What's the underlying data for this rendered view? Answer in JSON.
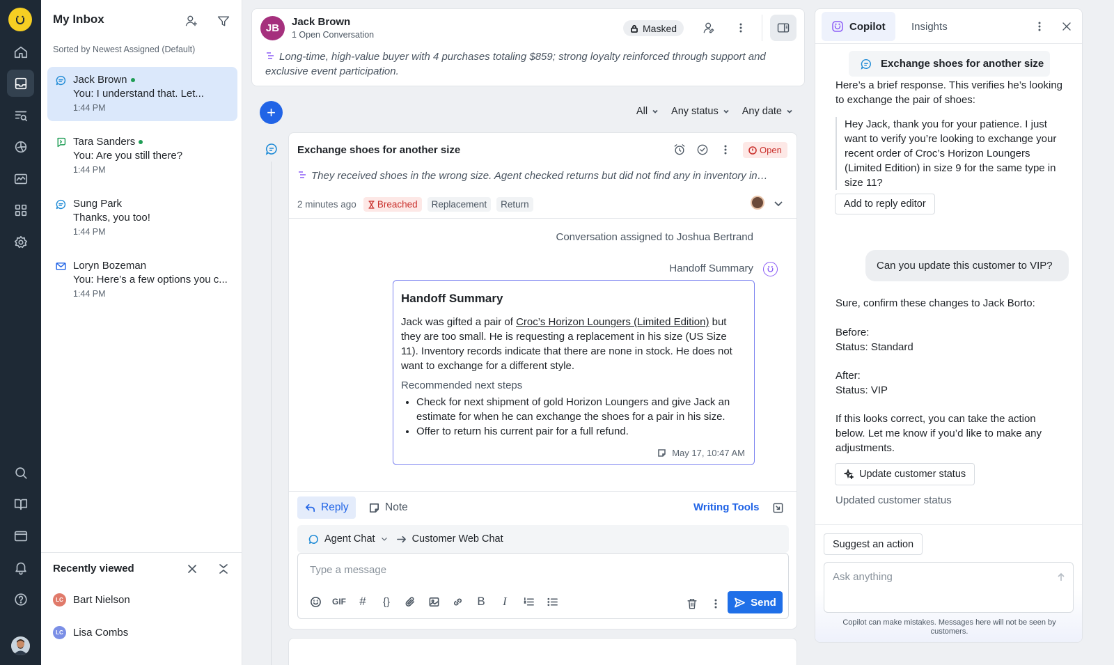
{
  "nav": {
    "items": [
      "home-icon",
      "inbox-icon",
      "reports-icon",
      "analytics-icon",
      "monitor-icon",
      "apps-icon",
      "settings-icon",
      "search-icon",
      "knowledge-icon",
      "screen-icon",
      "bell-icon",
      "help-icon"
    ]
  },
  "inbox": {
    "title": "My Inbox",
    "sorted": "Sorted by Newest Assigned (Default)",
    "conversations": [
      {
        "name": "Jack Brown",
        "preview": "You: I understand that. Let...",
        "time": "1:44 PM",
        "online": true,
        "channel": "chat"
      },
      {
        "name": "Tara Sanders",
        "preview": "You: Are you still there?",
        "time": "1:44 PM",
        "online": true,
        "channel": "sms"
      },
      {
        "name": "Sung Park",
        "preview": "Thanks, you too!",
        "time": "1:44 PM",
        "online": false,
        "channel": "chat"
      },
      {
        "name": "Loryn Bozeman",
        "preview": "You: Here’s a few options you c...",
        "time": "1:44 PM",
        "online": false,
        "channel": "email"
      }
    ],
    "recent": {
      "title": "Recently viewed",
      "items": [
        {
          "initials": "LC",
          "name": "Bart Nielson",
          "color": "#e07a6a"
        },
        {
          "initials": "LC",
          "name": "Lisa Combs",
          "color": "#7b8fe6"
        }
      ]
    }
  },
  "contact": {
    "initials": "JB",
    "name": "Jack Brown",
    "open": "1 Open Conversation",
    "masked": "Masked",
    "summary": "Long-time, high-value buyer with 4 purchases totaling $859; strong loyalty reinforced through support and exclusive event participation."
  },
  "filters": {
    "all": "All",
    "status": "Any status",
    "date": "Any date"
  },
  "conversation": {
    "title": "Exchange shoes for another size",
    "status": "Open",
    "summary": "They received shoes in the wrong size. Agent checked returns but did not find any in inventory in…",
    "ago": "2 minutes ago",
    "tags": [
      "Breached",
      "Replacement",
      "Return"
    ],
    "assigned": "Conversation assigned to Joshua Bertrand",
    "handoff_label": "Handoff Summary",
    "handoff": {
      "title": "Handoff Summary",
      "p1": "Jack was gifted a pair of ",
      "link": "Croc’s Horizon Loungers (Limited Edition)",
      "p2": " but they are too small. He is requesting a replacement in his size (US Size 11). Inventory records indicate that there are none in stock. He does not want to exchange for a different style.",
      "rec": "Recommended next steps",
      "steps": [
        "Check for next shipment of gold Horizon Loungers and give Jack an estimate for when he can exchange the shoes for a pair in his size.",
        "Offer to return his current pair for a full refund."
      ],
      "date": "May 17, 10:47 AM"
    }
  },
  "reply": {
    "reply": "Reply",
    "note": "Note",
    "writing": "Writing Tools",
    "from": "Agent Chat",
    "to": "Customer Web Chat",
    "placeholder": "Type a message",
    "send": "Send",
    "gif": "GIF",
    "hash": "#",
    "braces": "{}",
    "bold": "B",
    "italic": "I"
  },
  "copilot": {
    "tab_copilot": "Copilot",
    "tab_insights": "Insights",
    "topic": "Exchange shoes for another size",
    "intro": "Here’s a brief response. This verifies he’s looking to exchange the pair of shoes:",
    "quote": "Hey Jack, thank you for your patience. I just want to verify you’re looking to exchange your recent order of Croc’s Horizon Loungers (Limited Edition) in size 9 for the same type in size 11?",
    "add": "Add to reply editor",
    "user_msg": "Can you update this customer to VIP?",
    "confirm": "Sure, confirm these changes to Jack Borto:",
    "before": "Before:",
    "before_status": "Status: Standard",
    "after": "After:",
    "after_status": "Status: VIP",
    "closing": "If this looks correct, you can take the action below. Let me know if you’d like to make any adjustments.",
    "action": "Update customer status",
    "updated": "Updated customer status",
    "suggest": "Suggest an action",
    "ask_placeholder": "Ask anything",
    "disclaimer": "Copilot can make mistakes. Messages here will not be seen by customers."
  }
}
